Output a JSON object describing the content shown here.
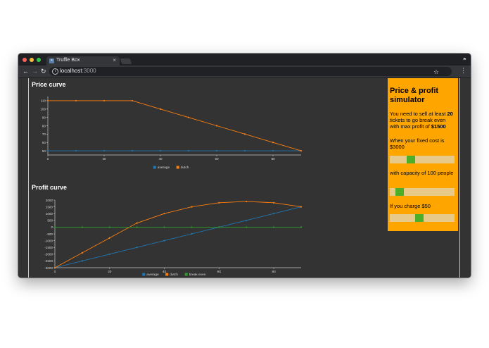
{
  "browser": {
    "tab_title": "Truffle Box",
    "tab_close": "×",
    "url_host": "localhost",
    "url_port": ":3000",
    "icons": {
      "back": "arrow-left-icon",
      "forward": "arrow-right-icon",
      "reload": "reload-icon",
      "info": "info-icon",
      "bookmark": "star-icon",
      "menu": "kebab-menu-icon",
      "incognito": "incognito-icon"
    }
  },
  "price_curve": {
    "heading": "Price curve"
  },
  "profit_curve": {
    "heading": "Profit curve"
  },
  "chart_data": [
    {
      "type": "line",
      "x": [
        0,
        10,
        20,
        30,
        40,
        50,
        60,
        70,
        80,
        90
      ],
      "series": [
        {
          "name": "average",
          "color": "#1f77b4",
          "values": [
            50,
            50,
            50,
            50,
            50,
            50,
            50,
            50,
            50,
            50
          ]
        },
        {
          "name": "dutch",
          "color": "#ff7f0e",
          "values": [
            110,
            110,
            110,
            110,
            100,
            90,
            80,
            70,
            60,
            50
          ]
        }
      ],
      "xlim": [
        0,
        90
      ],
      "ylim": [
        45,
        115
      ],
      "xticks": [
        "0",
        "20",
        "40",
        "60",
        "80"
      ],
      "yticks": [
        "50",
        "60",
        "70",
        "80",
        "90",
        "100",
        "110"
      ],
      "legend_position": "bottom-center"
    },
    {
      "type": "line",
      "x": [
        0,
        10,
        20,
        30,
        40,
        50,
        60,
        70,
        80,
        90
      ],
      "series": [
        {
          "name": "average",
          "color": "#1f77b4",
          "values": [
            -3000,
            -2500,
            -2000,
            -1500,
            -1000,
            -500,
            0,
            500,
            1000,
            1500
          ]
        },
        {
          "name": "dutch",
          "color": "#ff7f0e",
          "values": [
            -3000,
            -1900,
            -800,
            300,
            1000,
            1500,
            1800,
            1900,
            1800,
            1500
          ]
        },
        {
          "name": "break even",
          "color": "#2ca02c",
          "values": [
            0,
            0,
            0,
            0,
            0,
            0,
            0,
            0,
            0,
            0
          ]
        }
      ],
      "xlim": [
        0,
        90
      ],
      "ylim": [
        -3000,
        2000
      ],
      "xticks": [
        "0",
        "20",
        "40",
        "60",
        "80"
      ],
      "yticks": [
        "-3000",
        "-2500",
        "-2000",
        "-1500",
        "-1000",
        "-500",
        "0",
        "500",
        "1000",
        "1500",
        "2000"
      ],
      "legend_position": "bottom-center"
    }
  ],
  "simulator": {
    "title": "Price & profit simulator",
    "break_even_prefix": "You need to sell at least ",
    "break_even_tickets": "20",
    "break_even_middle": " tickets to go break even with max profit of ",
    "break_even_profit": "$1500",
    "fixed_cost_label": "When your fixed cost is $3000",
    "fixed_cost_level": 0.3,
    "capacity_label": "with capacity of 100 people",
    "capacity_level": 0.1,
    "price_label": "If you charge $50",
    "price_level": 0.45,
    "colors": {
      "panel": "#ffa500",
      "slider_track": "#e7c98a",
      "slider_thumb": "#4caf27"
    }
  }
}
